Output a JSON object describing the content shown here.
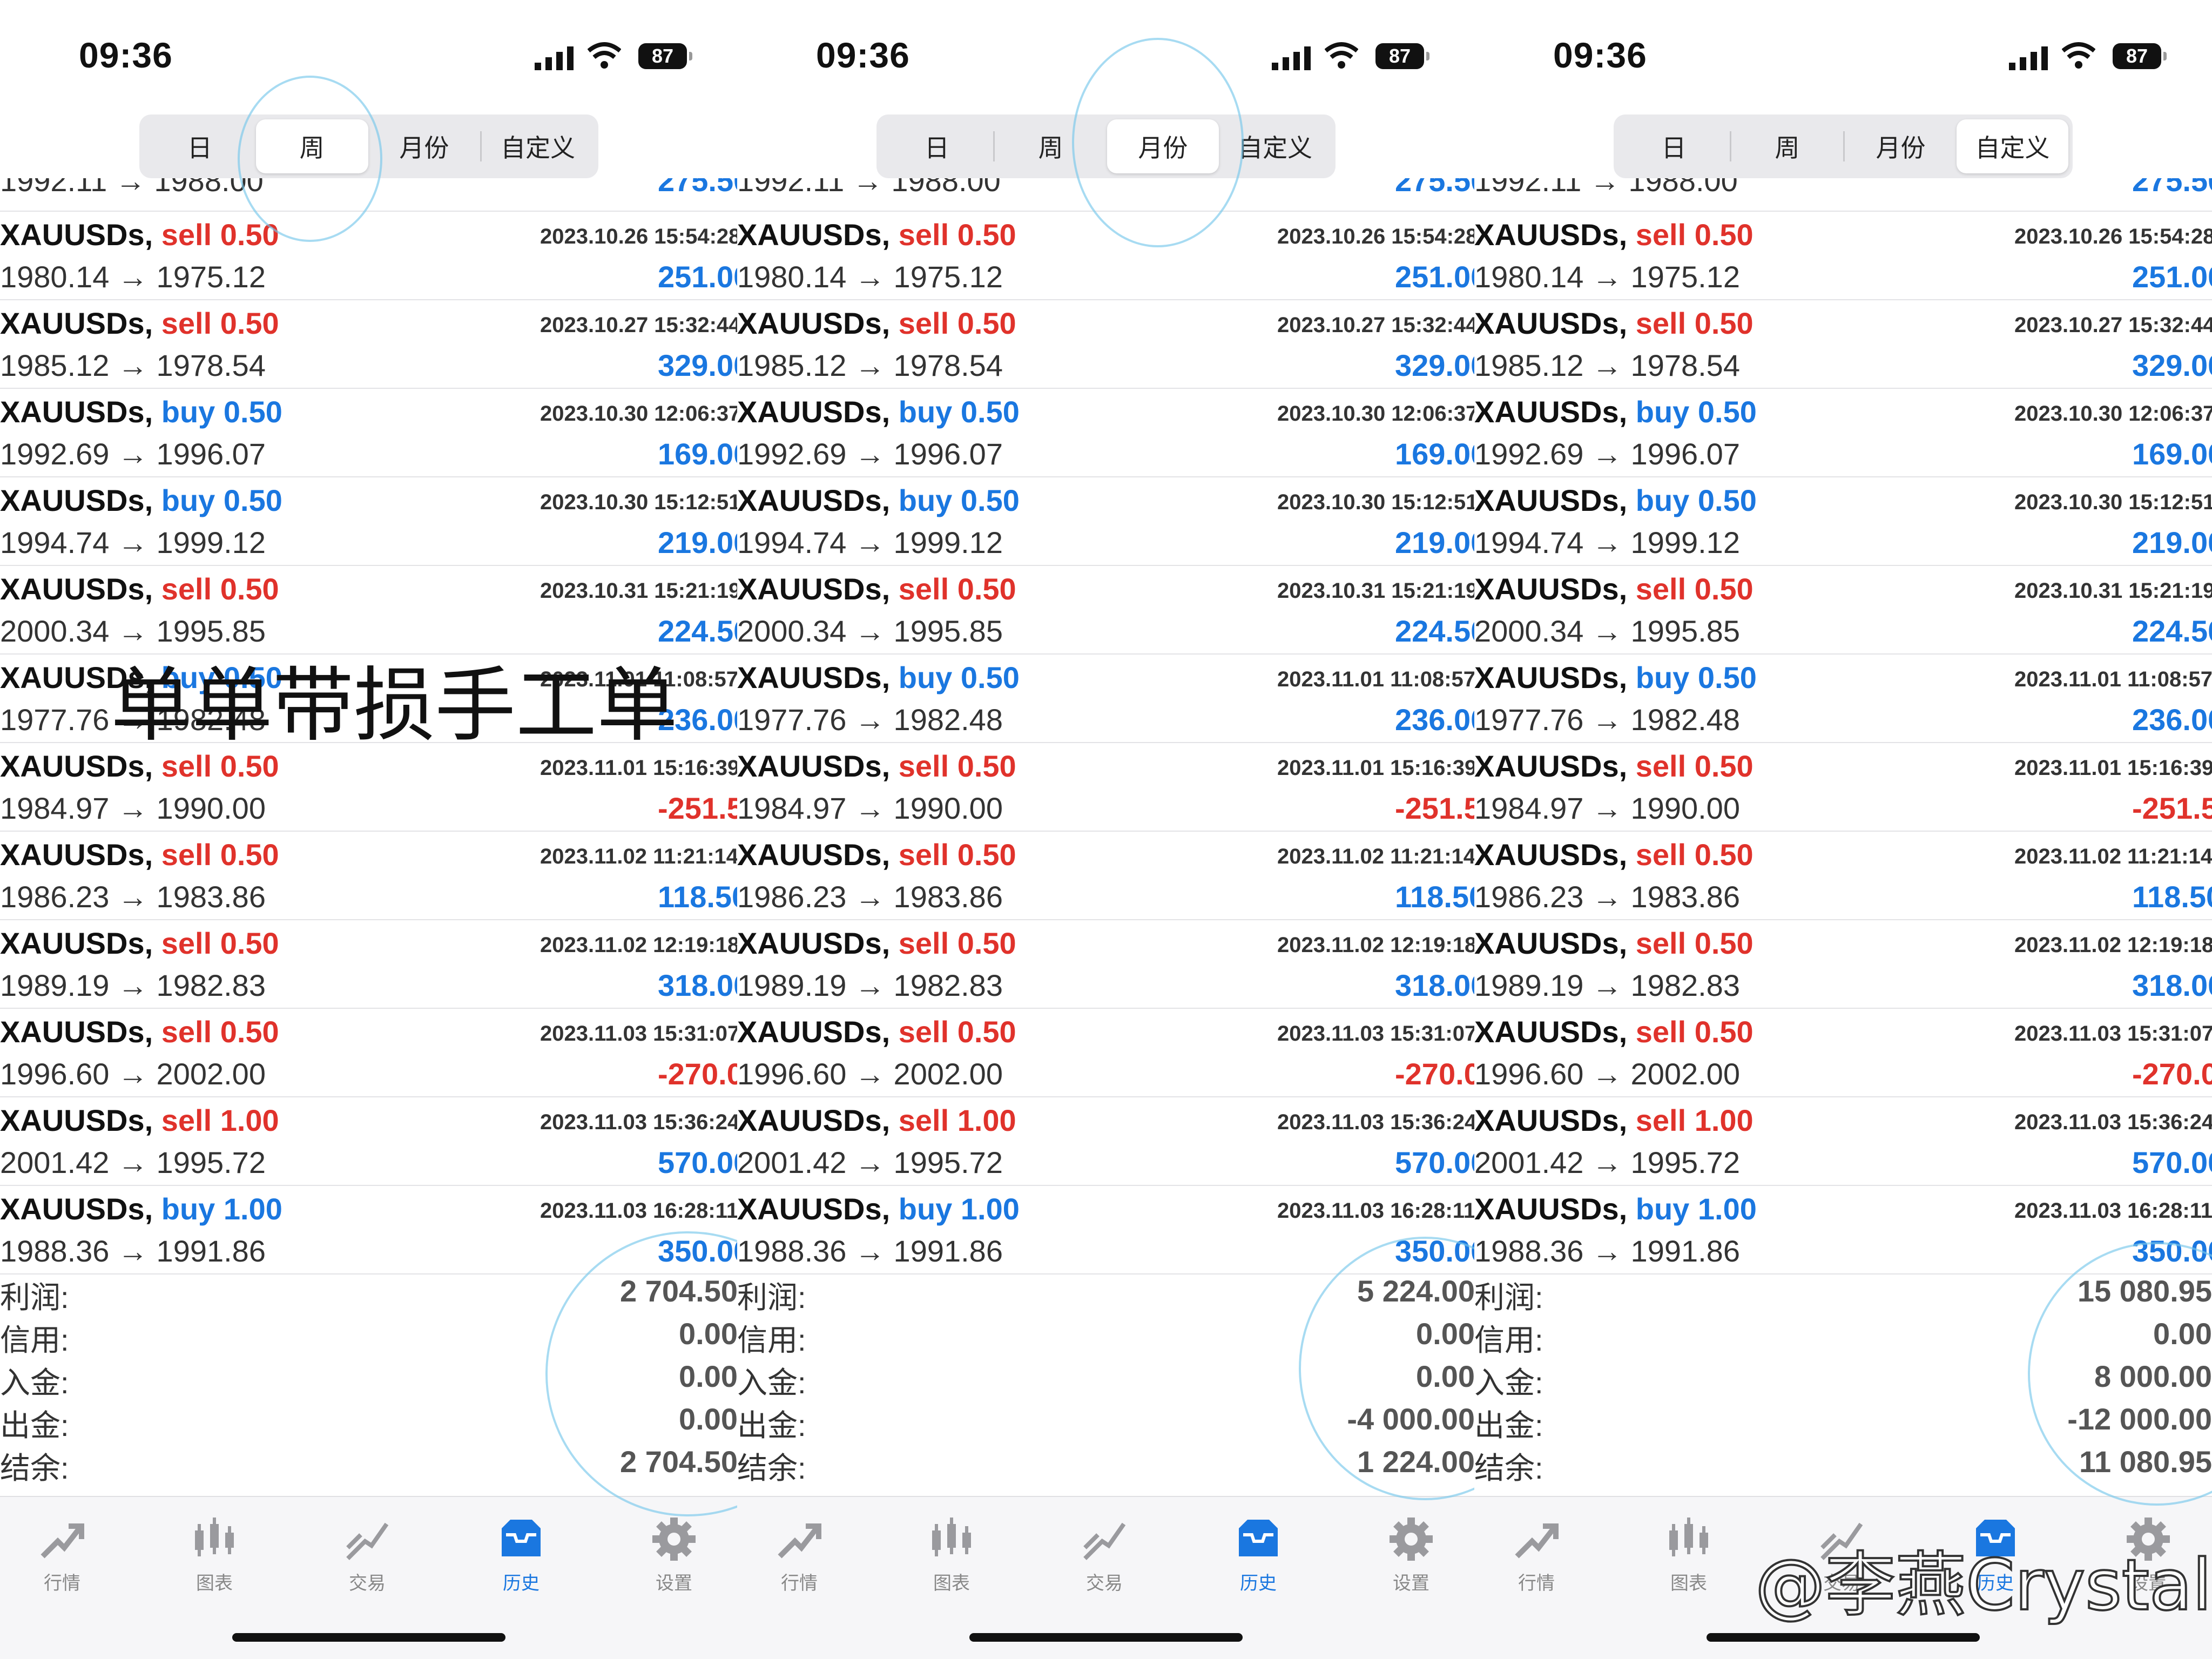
{
  "status": {
    "time": "09:36",
    "battery": "87"
  },
  "segments": [
    "日",
    "周",
    "月份",
    "自定义"
  ],
  "panels": [
    {
      "selected_segment": 1,
      "summary_values": [
        "2 704.50",
        "0.00",
        "0.00",
        "0.00",
        "2 704.50"
      ]
    },
    {
      "selected_segment": 2,
      "summary_values": [
        "5 224.00",
        "0.00",
        "0.00",
        "-4 000.00",
        "1 224.00"
      ]
    },
    {
      "selected_segment": 3,
      "summary_values": [
        "15 080.95",
        "0.00",
        "8 000.00",
        "-12 000.00",
        "11 080.95"
      ]
    }
  ],
  "partial_row": {
    "price": "1992.11 → 1988.00",
    "profit": "275.50"
  },
  "trades": [
    {
      "symbol": "XAUUSDs,",
      "action": "sell",
      "volume": "0.50",
      "date": "2023.10.26 15:54:28",
      "price": "1980.14 → 1975.12",
      "profit": "251.00",
      "sign": "pos"
    },
    {
      "symbol": "XAUUSDs,",
      "action": "sell",
      "volume": "0.50",
      "date": "2023.10.27 15:32:44",
      "price": "1985.12 → 1978.54",
      "profit": "329.00",
      "sign": "pos"
    },
    {
      "symbol": "XAUUSDs,",
      "action": "buy",
      "volume": "0.50",
      "date": "2023.10.30 12:06:37",
      "price": "1992.69 → 1996.07",
      "profit": "169.00",
      "sign": "pos"
    },
    {
      "symbol": "XAUUSDs,",
      "action": "buy",
      "volume": "0.50",
      "date": "2023.10.30 15:12:51",
      "price": "1994.74 → 1999.12",
      "profit": "219.00",
      "sign": "pos"
    },
    {
      "symbol": "XAUUSDs,",
      "action": "sell",
      "volume": "0.50",
      "date": "2023.10.31 15:21:19",
      "price": "2000.34 → 1995.85",
      "profit": "224.50",
      "sign": "pos"
    },
    {
      "symbol": "XAUUSDs,",
      "action": "buy",
      "volume": "0.50",
      "date": "2023.11.01 11:08:57",
      "price": "1977.76 → 1982.48",
      "profit": "236.00",
      "sign": "pos"
    },
    {
      "symbol": "XAUUSDs,",
      "action": "sell",
      "volume": "0.50",
      "date": "2023.11.01 15:16:39",
      "price": "1984.97 → 1990.00",
      "profit": "-251.50",
      "sign": "neg"
    },
    {
      "symbol": "XAUUSDs,",
      "action": "sell",
      "volume": "0.50",
      "date": "2023.11.02 11:21:14",
      "price": "1986.23 → 1983.86",
      "profit": "118.50",
      "sign": "pos"
    },
    {
      "symbol": "XAUUSDs,",
      "action": "sell",
      "volume": "0.50",
      "date": "2023.11.02 12:19:18",
      "price": "1989.19 → 1982.83",
      "profit": "318.00",
      "sign": "pos"
    },
    {
      "symbol": "XAUUSDs,",
      "action": "sell",
      "volume": "0.50",
      "date": "2023.11.03 15:31:07",
      "price": "1996.60 → 2002.00",
      "profit": "-270.00",
      "sign": "neg"
    },
    {
      "symbol": "XAUUSDs,",
      "action": "sell",
      "volume": "1.00",
      "date": "2023.11.03 15:36:24",
      "price": "2001.42 → 1995.72",
      "profit": "570.00",
      "sign": "pos"
    },
    {
      "symbol": "XAUUSDs,",
      "action": "buy",
      "volume": "1.00",
      "date": "2023.11.03 16:28:11",
      "price": "1988.36 → 1991.86",
      "profit": "350.00",
      "sign": "pos"
    }
  ],
  "summary_labels": [
    "利润:",
    "信用:",
    "入金:",
    "出金:",
    "结余:"
  ],
  "tabs": [
    {
      "label": "行情",
      "icon": "quotes-icon",
      "active": false
    },
    {
      "label": "图表",
      "icon": "chart-icon",
      "active": false
    },
    {
      "label": "交易",
      "icon": "trade-icon",
      "active": false
    },
    {
      "label": "历史",
      "icon": "history-icon",
      "active": true
    },
    {
      "label": "设置",
      "icon": "settings-icon",
      "active": false
    }
  ],
  "overlay_text": "单单带损手工单",
  "watermark": "@李燕Crystal",
  "colors": {
    "sell": "#e0322b",
    "buy": "#1a77e0",
    "positive": "#1a77e0",
    "negative": "#e0322b"
  }
}
